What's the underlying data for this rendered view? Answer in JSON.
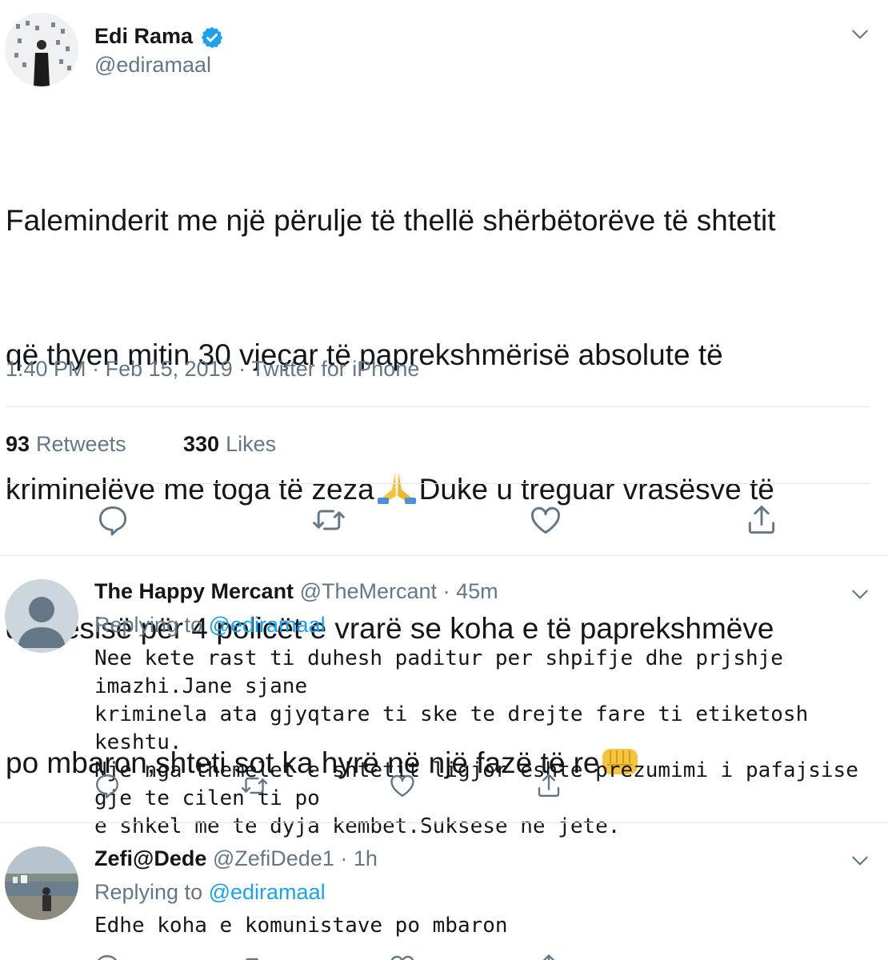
{
  "main_tweet": {
    "author_name": "Edi Rama",
    "author_handle": "@ediramaal",
    "verified_icon": "verified-badge-icon",
    "text_line1": "Faleminderit me një përulje të thellë shërbëtorëve të shtetit",
    "text_line2": "që thyen mitin 30 vjeçar të paprekshmërisë absolute të",
    "text_line3a": "kriminelëve me toga të zeza",
    "text_line3b": "Duke u treguar vrasësve të",
    "text_line4": "drejtësisë për 4 policët e vrarë se koha e të paprekshmëve",
    "text_line5": "po mbaron,shteti sot ka hyrë në një fazë të re",
    "time": "1:40 PM",
    "date": "Feb 15, 2019",
    "source": "Twitter for iPhone",
    "separator": "·",
    "retweets_count": "93",
    "retweets_label": "Retweets",
    "likes_count": "330",
    "likes_label": "Likes"
  },
  "replies": [
    {
      "author_name": "The Happy Mercant",
      "author_handle": "@TheMercant",
      "time": "45m",
      "replying_prefix": "Replying to",
      "replying_to": "@ediramaal",
      "text": "Nee kete rast ti duhesh paditur per shpifje dhe prjshje imazhi.Jane sjane\nkriminela ata gjyqtare ti ske te drejte fare ti etiketosh keshtu.\nNje nga themelet e shtetit ligjor eshte prezumimi i pafajsise gje te cilen ti po\ne shkel me te dyja kembet.Suksese ne jete."
    },
    {
      "author_name": "Zefi@Dede",
      "author_handle": "@ZefiDede1",
      "time": "1h",
      "replying_prefix": "Replying to",
      "replying_to": "@ediramaal",
      "text": "Edhe koha e komunistave po mbaron"
    }
  ],
  "colors": {
    "text": "#14171a",
    "secondary": "#657786",
    "link": "#1da1f2",
    "divider": "#e1e8ed",
    "verified": "#1da1f2"
  }
}
